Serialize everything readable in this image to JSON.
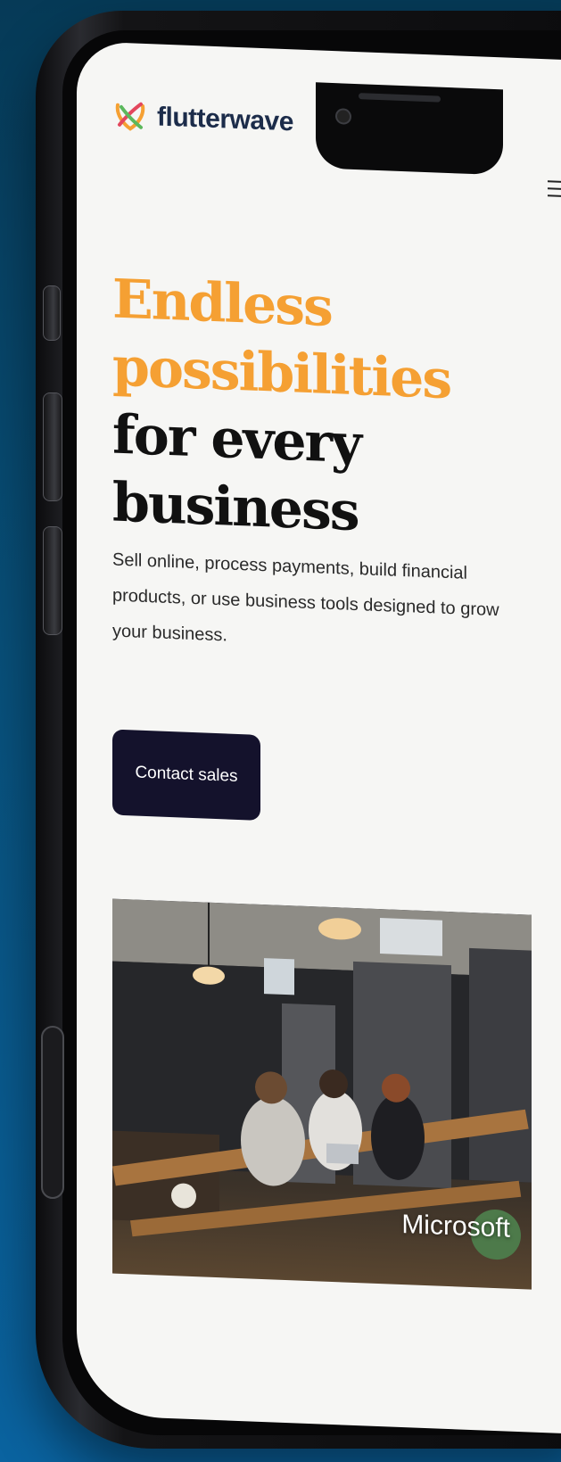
{
  "brand": {
    "name": "flutterwave",
    "logo_icon": "flutterwave-logo-icon",
    "text_color": "#1c2c4a"
  },
  "header": {
    "menu_icon": "hamburger-menu-icon"
  },
  "hero": {
    "title_accent": "Endless possibilities",
    "title_rest": "for every business",
    "accent_color": "#f5a033",
    "description": "Sell online, process payments, build financial products, or use business tools designed to grow your business.",
    "cta_label": "Contact sales",
    "cta_color": "#14122c"
  },
  "showcase": {
    "caption": "Microsoft"
  }
}
